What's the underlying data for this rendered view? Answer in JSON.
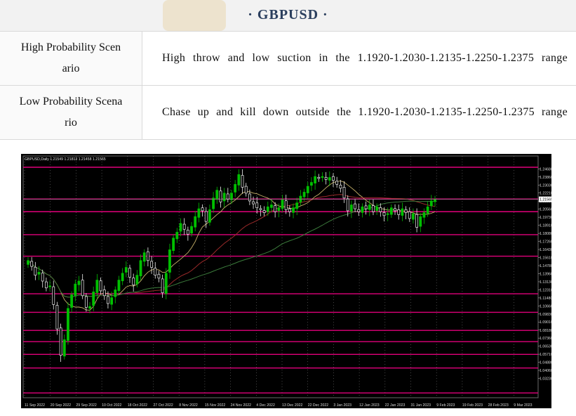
{
  "header": {
    "title": "· GBPUSD ·"
  },
  "scenarios": [
    {
      "label": "High Probability Scenario",
      "label_lines": [
        "High Probability Scen",
        "ario"
      ],
      "text": "High throw and low suction in the 1.1920-1.2030-1.2135-1.2250-1.2375 range"
    },
    {
      "label": "Low Probability Scenario",
      "label_lines": [
        "Low Probability Scena",
        "rio"
      ],
      "text": "Chase up and kill down outside the 1.1920-1.2030-1.2135-1.2250-1.2375 range"
    }
  ],
  "chart_data": {
    "type": "candlestick",
    "title": "GBPUSD,Daily 1.21549 1.21813 1.21458 1.21565",
    "symbol": "GBPUSD",
    "timeframe": "Daily",
    "ohlc_header": {
      "open": 1.21549,
      "high": 1.21813,
      "low": 1.21458,
      "close": 1.21565
    },
    "current_price": 1.21565,
    "ylim": [
      1.0126,
      1.26
    ],
    "y_ticks": [
      1.2468,
      1.2386,
      1.2303,
      1.2221,
      1.2138,
      1.2056,
      1.1973,
      1.1891,
      1.1808,
      1.1726,
      1.1643,
      1.1561,
      1.1478,
      1.1396,
      1.1313,
      1.1231,
      1.1148,
      1.1066,
      1.0983,
      1.0901,
      1.0818,
      1.0736,
      1.0653,
      1.0571,
      1.0488,
      1.0406,
      1.0323
    ],
    "y_tick_labels": [
      "1.24680",
      "1.23860",
      "1.23030",
      "1.22210",
      "1.21380",
      "1.20560",
      "1.19730",
      "1.18910",
      "1.18080",
      "1.17260",
      "1.16430",
      "1.15610",
      "1.14780",
      "1.13960",
      "1.13130",
      "1.12310",
      "1.11480",
      "1.10660",
      "1.09830",
      "1.09010",
      "1.08180",
      "1.07360",
      "1.06530",
      "1.05710",
      "1.04880",
      "1.04060",
      "1.03230"
    ],
    "x_tick_labels": [
      "11 Sep 2022",
      "20 Sep 2022",
      "29 Sep 2022",
      "10 Oct 2022",
      "18 Oct 2022",
      "27 Oct 2022",
      "8 Nov 2022",
      "15 Nov 2022",
      "24 Nov 2022",
      "4 Dec 2022",
      "13 Dec 2022",
      "22 Dec 2022",
      "3 Jan 2023",
      "12 Jan 2023",
      "22 Jan 2023",
      "31 Jan 2023",
      "9 Feb 2023",
      "19 Feb 2023",
      "28 Feb 2023",
      "9 Mar 2023"
    ],
    "levels": [
      1.2485,
      1.216,
      1.203,
      1.1795,
      1.1575,
      1.119,
      1.1,
      1.0815,
      1.07,
      1.057,
      1.043,
      1.0175
    ],
    "grid": true,
    "colors": {
      "background": "#000000",
      "bull": "#00c000",
      "bear": "#f0f0f0",
      "level": "#e0007a",
      "grid": "#d0d0d0"
    },
    "closes": [
      1.153,
      1.147,
      1.138,
      1.141,
      1.132,
      1.125,
      1.127,
      1.108,
      1.083,
      1.056,
      1.072,
      1.104,
      1.118,
      1.129,
      1.132,
      1.117,
      1.105,
      1.106,
      1.121,
      1.133,
      1.122,
      1.117,
      1.109,
      1.115,
      1.123,
      1.133,
      1.14,
      1.146,
      1.136,
      1.128,
      1.138,
      1.153,
      1.161,
      1.153,
      1.146,
      1.138,
      1.135,
      1.12,
      1.14,
      1.164,
      1.176,
      1.182,
      1.191,
      1.185,
      1.18,
      1.188,
      1.198,
      1.206,
      1.204,
      1.193,
      1.205,
      1.217,
      1.225,
      1.213,
      1.222,
      1.216,
      1.222,
      1.231,
      1.241,
      1.228,
      1.222,
      1.214,
      1.211,
      1.207,
      1.205,
      1.202,
      1.208,
      1.21,
      1.203,
      1.207,
      1.215,
      1.205,
      1.203,
      1.207,
      1.212,
      1.219,
      1.223,
      1.229,
      1.233,
      1.239,
      1.237,
      1.239,
      1.236,
      1.238,
      1.235,
      1.231,
      1.227,
      1.217,
      1.204,
      1.21,
      1.206,
      1.203,
      1.208,
      1.206,
      1.21,
      1.203,
      1.208,
      1.203,
      1.199,
      1.201,
      1.207,
      1.204,
      1.2,
      1.206,
      1.202,
      1.196,
      1.201,
      1.187,
      1.198,
      1.202,
      1.208,
      1.214,
      1.2157
    ]
  }
}
